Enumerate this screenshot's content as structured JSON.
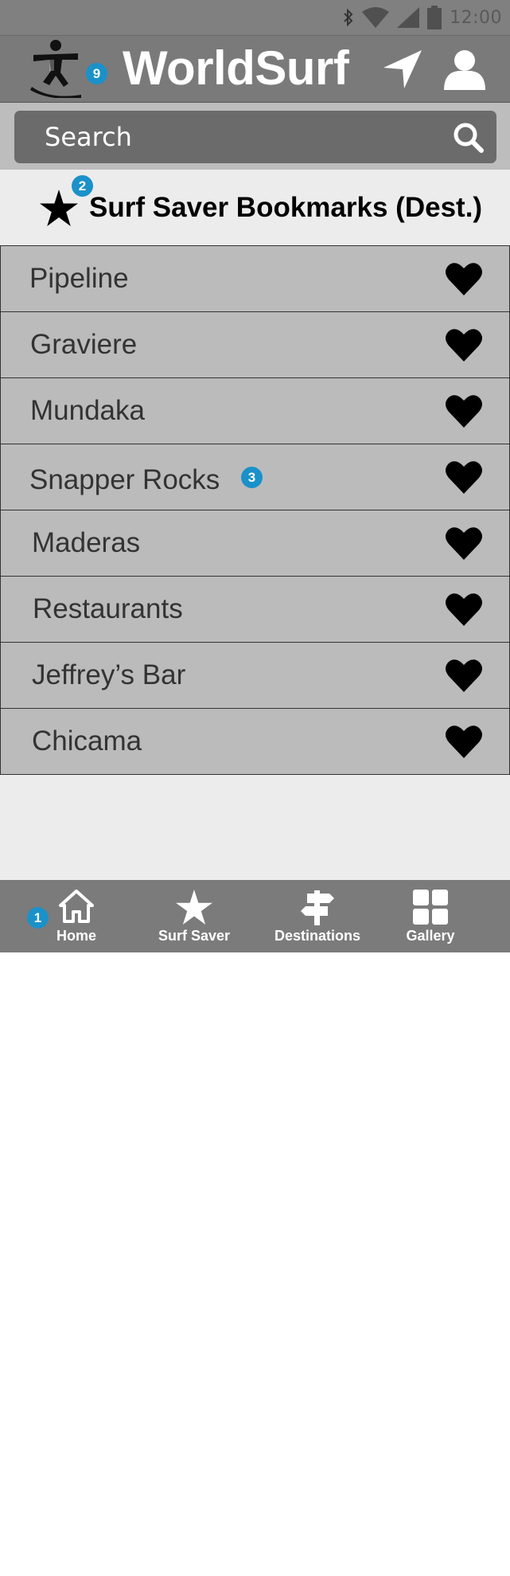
{
  "status_bar": {
    "time": "12:00",
    "icons": [
      "bluetooth-icon",
      "wifi-icon",
      "cell-signal-icon",
      "battery-icon"
    ]
  },
  "app_bar": {
    "title": "WorldSurf",
    "badge": "9",
    "icons": [
      "surfer-logo-icon",
      "location-arrow-icon",
      "user-icon"
    ]
  },
  "search": {
    "placeholder": "Search",
    "icon": "search-icon"
  },
  "section": {
    "title": "Surf Saver Bookmarks (Dest.)",
    "badge": "2",
    "icon": "star-icon"
  },
  "bookmarks": [
    {
      "label": "Pipeline"
    },
    {
      "label": "Graviere"
    },
    {
      "label": "Mundaka"
    },
    {
      "label": "Snapper Rocks",
      "badge": "3"
    },
    {
      "label": "Maderas"
    },
    {
      "label": "Restaurants"
    },
    {
      "label": "Jeffrey’s Bar"
    },
    {
      "label": "Chicama"
    }
  ],
  "nav": {
    "badge": "1",
    "items": [
      {
        "label": "Home",
        "icon": "home-icon"
      },
      {
        "label": "Surf Saver",
        "icon": "star-icon"
      },
      {
        "label": "Destinations",
        "icon": "signpost-icon"
      },
      {
        "label": "Gallery",
        "icon": "grid-icon"
      }
    ]
  },
  "colors": {
    "app_bar": "#7a7a7a",
    "status_bar": "#808080",
    "list_row": "#bbbbbb",
    "badge": "#1b91c9",
    "background": "#ececec"
  }
}
